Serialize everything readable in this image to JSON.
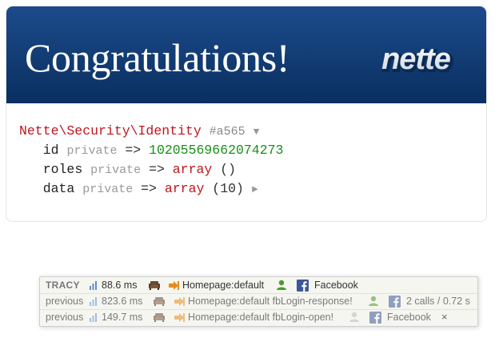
{
  "header": {
    "title": "Congratulations!",
    "logo_text": "nette"
  },
  "dump": {
    "class_name": "Nette\\Security\\Identity",
    "object_hash": "#a565",
    "expand_arrow": "▼",
    "props": [
      {
        "key": "id",
        "visibility": "private",
        "op": "=>",
        "value": "10205569662074273"
      },
      {
        "key": "roles",
        "visibility": "private",
        "op": "=>",
        "value_kw": "array",
        "value_rest": "()"
      },
      {
        "key": "data",
        "visibility": "private",
        "op": "=>",
        "value_kw": "array",
        "value_rest": "(10)",
        "toggle": "►"
      }
    ]
  },
  "tracy": {
    "label": "TRACY",
    "rows": [
      {
        "prefix": "",
        "time": "88.6 ms",
        "request": "Homepage:default",
        "facebook": "Facebook"
      },
      {
        "prefix": "previous",
        "time": "823.6 ms",
        "request": "Homepage:default fbLogin-response!",
        "facebook": "2 calls / 0.72 s"
      },
      {
        "prefix": "previous",
        "time": "149.7 ms",
        "request": "Homepage:default fbLogin-open!",
        "facebook": "Facebook",
        "close": "×"
      }
    ]
  },
  "colors": {
    "header_top": "#1c4b8b",
    "header_bottom": "#0a2f60",
    "class_red": "#c0161d",
    "number_green": "#1a8e1a",
    "facebook_blue": "#3b5998",
    "user_green": "#4a9a2c"
  },
  "icons": [
    "bar-chart-icon",
    "sofa-icon",
    "enter-arrow-icon",
    "user-icon",
    "facebook-icon",
    "close-icon"
  ]
}
